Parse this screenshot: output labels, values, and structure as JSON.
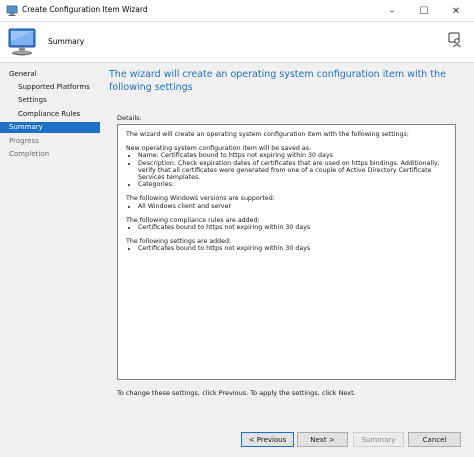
{
  "window": {
    "title": "Create Configuration Item Wizard",
    "controls": {
      "minimize": "–",
      "maximize": "☐",
      "close": "✕"
    }
  },
  "header": {
    "title": "Summary",
    "icon": "computer-monitor-icon",
    "help_icon": "help-person-icon"
  },
  "nav": {
    "items": [
      {
        "label": "General",
        "level": 0,
        "state": "normal"
      },
      {
        "label": "Supported Platforms",
        "level": 1,
        "state": "normal"
      },
      {
        "label": "Settings",
        "level": 1,
        "state": "normal"
      },
      {
        "label": "Compliance Rules",
        "level": 1,
        "state": "normal"
      },
      {
        "label": "Summary",
        "level": 0,
        "state": "active"
      },
      {
        "label": "Progress",
        "level": 0,
        "state": "dim"
      },
      {
        "label": "Completion",
        "level": 0,
        "state": "dim"
      }
    ]
  },
  "main": {
    "title": "The wizard will create an operating system configuration item with the following settings",
    "details_label": "Details:",
    "details": {
      "intro": "The wizard will create an operating system configuration item with the following settings:",
      "saved_as": "New operating system configuration item will be saved as:",
      "saved_items": [
        "Name: Certificates bound to https not expiring within 30 days",
        "Description: Check expiration dates of certificates that are used on https bindings.  Additionally, verify that all certificates were generated from one of a couple of Active Directory Certificate Services templates.",
        "Categories:"
      ],
      "windows_heading": "The following Windows versions are supported:",
      "windows_items": [
        "All Windows client and server"
      ],
      "rules_heading": "The following compliance rules are added:",
      "rules_items": [
        "Certificates bound to https not expiring within 30 days"
      ],
      "settings_heading": "The following settings are added:",
      "settings_items": [
        "Certificates bound to https not expiring within 30 days"
      ]
    },
    "footer_text": "To change these settings, click Previous. To apply the settings, click Next."
  },
  "buttons": {
    "previous": "< Previous",
    "next": "Next >",
    "summary": "Summary",
    "cancel": "Cancel"
  },
  "colors": {
    "accent": "#1e6fc6",
    "nav_active_bg": "#1e6fc6",
    "background": "#f0f0f0"
  }
}
